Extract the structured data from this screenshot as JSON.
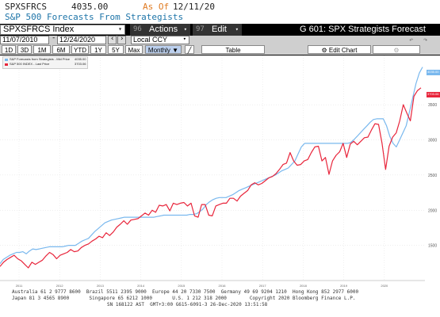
{
  "header": {
    "ticker": "SPXSFRCS",
    "value": "4035.00",
    "as_of_label": "As Of",
    "as_of_date": "12/11/20",
    "subtitle": "S&P 500 Forecasts From Strategists"
  },
  "toolbar1": {
    "security": "SPXSFRCS Index",
    "actions_num": "96",
    "actions_label": "Actions",
    "edit_num": "97",
    "edit_label": "Edit",
    "function_title": "G 601: SPX Strategists Forecast"
  },
  "toolbar2": {
    "start_date": "11/07/2010",
    "end_date": "12/24/2020",
    "currency": "Local CCY",
    "table_label": "Table",
    "edit_chart_label": "Edit Chart"
  },
  "periods": [
    "1D",
    "3D",
    "1M",
    "6M",
    "YTD",
    "1Y",
    "5Y",
    "Max"
  ],
  "frequency": "Monthly",
  "legend": [
    {
      "name": "S&P Forecasts from Strategists - Mid Price",
      "value": "4035.00",
      "color": "#79b8ee"
    },
    {
      "name": "S&P 500 INDEX - Last Price",
      "value": "3703.06",
      "color": "#e8253b"
    }
  ],
  "right_labels": {
    "blue": "4035.00",
    "red": "3703.06"
  },
  "chart_data": {
    "type": "line",
    "x_labels": [
      "2011",
      "2012",
      "2013",
      "2014",
      "2015",
      "2016",
      "2017",
      "2018",
      "2019",
      "2020"
    ],
    "y_ticks": [
      1500,
      2000,
      2500,
      3000,
      3500
    ],
    "ylim": [
      1000,
      4200
    ],
    "series": [
      {
        "name": "S&P Forecasts from Strategists - Mid Price",
        "color": "#79b8ee",
        "values": [
          1240,
          1300,
          1330,
          1360,
          1380,
          1400,
          1400,
          1410,
          1380,
          1420,
          1450,
          1440,
          1450,
          1460,
          1470,
          1480,
          1480,
          1480,
          1480,
          1480,
          1490,
          1500,
          1500,
          1500,
          1530,
          1560,
          1580,
          1600,
          1650,
          1700,
          1740,
          1780,
          1820,
          1840,
          1860,
          1870,
          1880,
          1890,
          1900,
          1900,
          1900,
          1900,
          1900,
          1900,
          1900,
          1900,
          1900,
          1900,
          1910,
          1920,
          1930,
          1930,
          1930,
          1930,
          1930,
          1930,
          1930,
          1930,
          1940,
          1940,
          1950,
          1980,
          2020,
          2080,
          2120,
          2150,
          2170,
          2180,
          2180,
          2180,
          2200,
          2220,
          2250,
          2280,
          2300,
          2320,
          2340,
          2360,
          2380,
          2400,
          2420,
          2440,
          2460,
          2480,
          2500,
          2530,
          2560,
          2580,
          2600,
          2650,
          2700,
          2800,
          2900,
          2950,
          2950,
          2950,
          2950,
          2950,
          2950,
          2950,
          2950,
          2950,
          2950,
          2950,
          2950,
          2950,
          2950,
          2960,
          3000,
          3050,
          3100,
          3150,
          3200,
          3250,
          3290,
          3300,
          3300,
          3300,
          3200,
          3050,
          2950,
          2900,
          3000,
          3100,
          3200,
          3400,
          3600,
          3800,
          3950,
          4035
        ]
      },
      {
        "name": "S&P 500 INDEX - Last Price",
        "color": "#e8253b",
        "values": [
          1200,
          1260,
          1300,
          1330,
          1360,
          1310,
          1280,
          1230,
          1180,
          1260,
          1230,
          1260,
          1290,
          1350,
          1400,
          1370,
          1310,
          1360,
          1380,
          1400,
          1440,
          1410,
          1420,
          1470,
          1500,
          1520,
          1560,
          1590,
          1630,
          1610,
          1680,
          1640,
          1690,
          1760,
          1800,
          1850,
          1800,
          1860,
          1870,
          1880,
          1920,
          1960,
          1930,
          2000,
          1970,
          2070,
          2060,
          2080,
          1990,
          2100,
          2080,
          2100,
          2110,
          2060,
          2100,
          1920,
          1900,
          2080,
          2080,
          1930,
          1920,
          2060,
          2080,
          2100,
          2100,
          2170,
          2170,
          2130,
          2200,
          2240,
          2280,
          2360,
          2390,
          2360,
          2380,
          2420,
          2460,
          2480,
          2520,
          2580,
          2650,
          2670,
          2820,
          2700,
          2640,
          2650,
          2700,
          2720,
          2820,
          2900,
          2910,
          2700,
          2750,
          2510,
          2700,
          2780,
          2830,
          2950,
          2750,
          2940,
          2980,
          2930,
          2980,
          3030,
          3040,
          3140,
          3230,
          3220,
          2950,
          2580,
          2910,
          3040,
          3100,
          3270,
          3500,
          3380,
          3270,
          3620,
          3700,
          3740
        ]
      }
    ]
  },
  "footer": {
    "line1": "Australia 61 2 9777 8600  Brazil 5511 2395 9000  Europe 44 20 7330 7500  Germany 49 69 9204 1210  Hong Kong 852 2977 6000",
    "line2": "Japan 81 3 4565 8900       Singapore 65 6212 1000       U.S. 1 212 318 2000        Copyright 2020 Bloomberg Finance L.P.",
    "line3": "SN 168122 AST  GMT+3:00 G615-6091-3 26-Dec-2020 13:51:58"
  }
}
